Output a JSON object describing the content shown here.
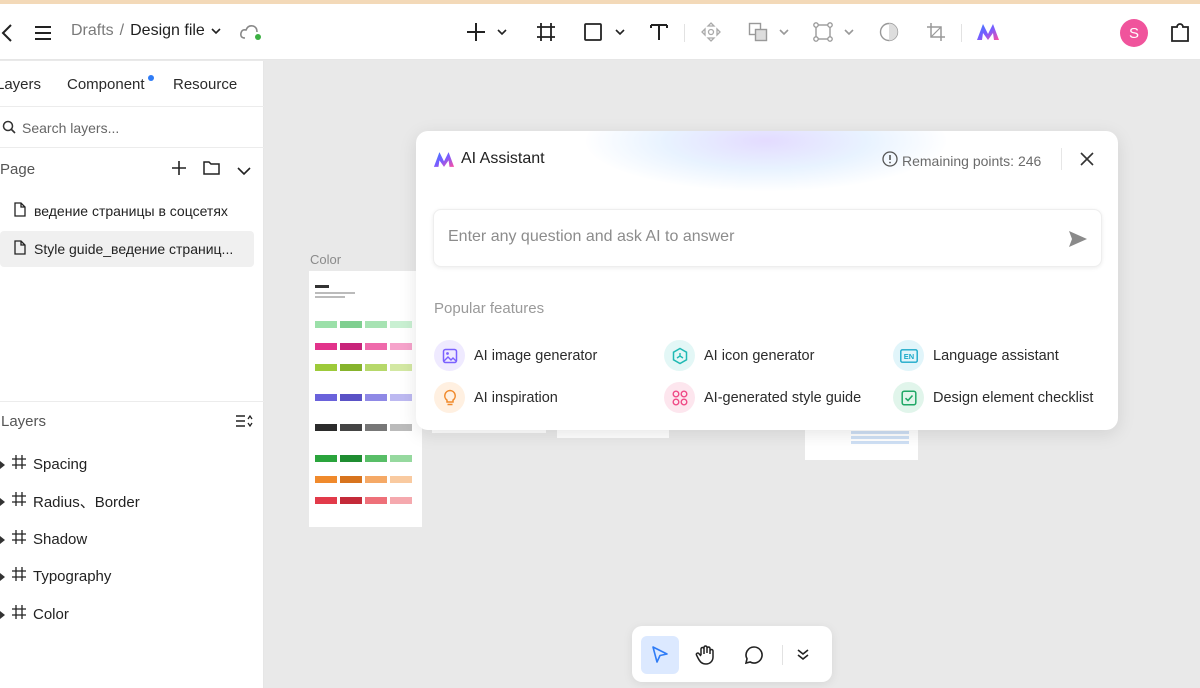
{
  "topbar": {
    "breadcrumb_parent": "Drafts",
    "breadcrumb_sep": "/",
    "file_name": "Design file",
    "avatar_letter": "S"
  },
  "left_panel": {
    "tabs": [
      {
        "label": "Layers"
      },
      {
        "label": "Component"
      },
      {
        "label": "Resource"
      }
    ],
    "search_placeholder": "Search layers...",
    "page_header": "Page",
    "pages": [
      {
        "label": "ведение страницы в соцсетях"
      },
      {
        "label": "Style guide_ведение страниц..."
      }
    ],
    "layers_header": "Layers",
    "layers": [
      {
        "label": "Spacing"
      },
      {
        "label": "Radius、Border"
      },
      {
        "label": "Shadow"
      },
      {
        "label": "Typography"
      },
      {
        "label": "Color"
      }
    ]
  },
  "canvas": {
    "frame_label": "Color"
  },
  "ai_assistant": {
    "title": "AI Assistant",
    "remaining_points": "Remaining points: 246",
    "input_placeholder": "Enter any question and ask AI to answer",
    "section_title": "Popular features",
    "features": [
      {
        "label": "AI image generator",
        "icon": "image-icon",
        "color": "#7b61ff",
        "bg": "#efeaff"
      },
      {
        "label": "AI icon generator",
        "icon": "hexagon-icon",
        "color": "#1fb9b3",
        "bg": "#e3f7f6"
      },
      {
        "label": "Language assistant",
        "icon": "en-icon",
        "color": "#1aa9c9",
        "bg": "#e1f5fa"
      },
      {
        "label": "AI inspiration",
        "icon": "bulb-icon",
        "color": "#f08a2c",
        "bg": "#fff0e1"
      },
      {
        "label": "AI-generated style guide",
        "icon": "grid-icon",
        "color": "#ef4a86",
        "bg": "#fde6ee"
      },
      {
        "label": "Design element checklist",
        "icon": "check-icon",
        "color": "#20a866",
        "bg": "#e1f5eb"
      }
    ]
  },
  "colors": {
    "accent": "#2f7cf6",
    "avatar": "#f0549c"
  }
}
